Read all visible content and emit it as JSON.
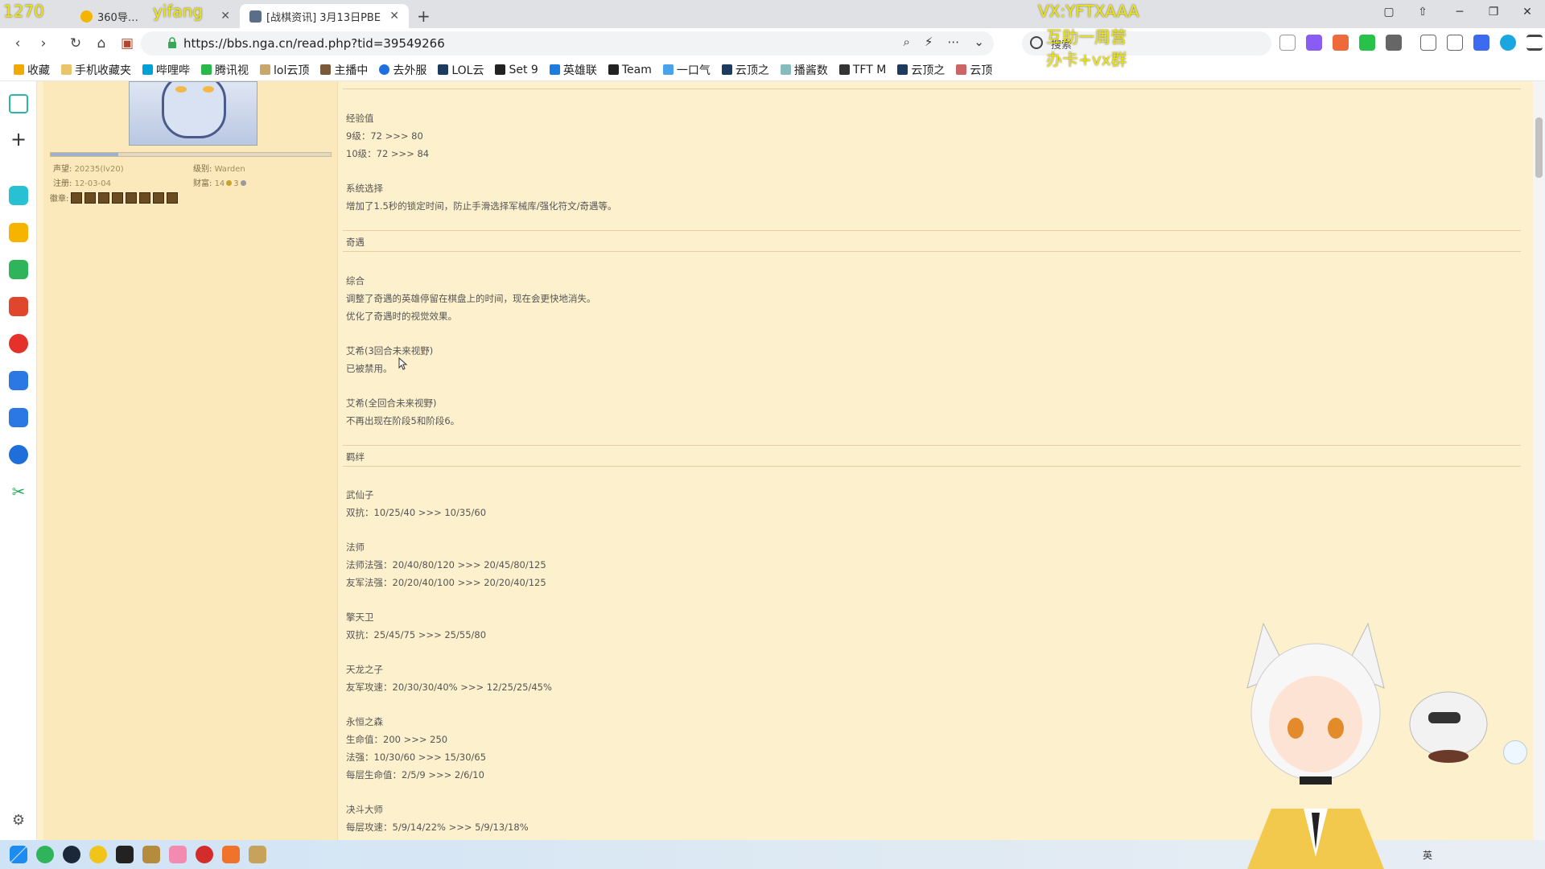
{
  "browser": {
    "tabs": [
      {
        "title": "360导…"
      },
      {
        "title": "[战棋资讯] 3月13日PBE"
      }
    ],
    "new_tab": "+",
    "url": "https://bbs.nga.cn/read.php?tid=39549266",
    "search_placeholder": "搜索"
  },
  "bookmarks": [
    {
      "label": "收藏"
    },
    {
      "label": "手机收藏夹"
    },
    {
      "label": "哔哩哔"
    },
    {
      "label": "腾讯视"
    },
    {
      "label": "lol云顶"
    },
    {
      "label": "主播中"
    },
    {
      "label": "去外服"
    },
    {
      "label": "LOL云"
    },
    {
      "label": "Set 9"
    },
    {
      "label": "英雄联"
    },
    {
      "label": "Team"
    },
    {
      "label": "一口气"
    },
    {
      "label": "云顶之"
    },
    {
      "label": "播酱数"
    },
    {
      "label": "TFT M"
    },
    {
      "label": "云顶之"
    },
    {
      "label": "云顶"
    }
  ],
  "user": {
    "reputation_label": "声望:",
    "reputation_value": "20235(lv20)",
    "level_label": "级别:",
    "level_value": "Warden",
    "register_label": "注册:",
    "register_value": "12-03-04",
    "wealth_label": "财富:",
    "wealth_value": "14",
    "wealth_value2": "3",
    "medals_label": "徽章:"
  },
  "post": {
    "lines": [
      {
        "t": "经验值"
      },
      {
        "t": "9级：72 >>> 80"
      },
      {
        "t": "10级：72 >>> 84"
      },
      {
        "t": "系统选择"
      },
      {
        "t": "增加了1.5秒的锁定时间，防止手滑选择军械库/强化符文/奇遇等。"
      },
      {
        "t": "奇遇"
      },
      {
        "t": "综合"
      },
      {
        "t": "调整了奇遇的英雄停留在棋盘上的时间，现在会更快地消失。"
      },
      {
        "t": "优化了奇遇时的视觉效果。"
      },
      {
        "t": "艾希(3回合未来视野)"
      },
      {
        "t": "已被禁用。"
      },
      {
        "t": "艾希(全回合未来视野)"
      },
      {
        "t": "不再出现在阶段5和阶段6。"
      },
      {
        "t": "羁绊"
      },
      {
        "t": "武仙子"
      },
      {
        "t": "双抗：10/25/40 >>> 10/35/60"
      },
      {
        "t": "法师"
      },
      {
        "t": "法师法强：20/40/80/120 >>> 20/45/80/125"
      },
      {
        "t": "友军法强：20/20/40/100 >>> 20/20/40/125"
      },
      {
        "t": "擎天卫"
      },
      {
        "t": "双抗：25/45/75 >>> 25/55/80"
      },
      {
        "t": "天龙之子"
      },
      {
        "t": "友军攻速：20/30/30/40% >>> 12/25/25/45%"
      },
      {
        "t": "永恒之森"
      },
      {
        "t": "生命值：200 >>> 250"
      },
      {
        "t": "法强：10/30/60 >>> 15/30/65"
      },
      {
        "t": "每层生命值：2/5/9 >>> 2/6/10"
      },
      {
        "t": "决斗大师"
      },
      {
        "t": "每层攻速：5/9/14/22% >>> 5/9/13/18%"
      }
    ]
  },
  "overlay": {
    "top_left_1": "1270",
    "top_left_2": "yifang",
    "vx": "VX:YFTXAAA",
    "sub1": "互助一周营",
    "sub2": "办卡+vx群"
  },
  "taskbar": {
    "tray_text": "英"
  }
}
